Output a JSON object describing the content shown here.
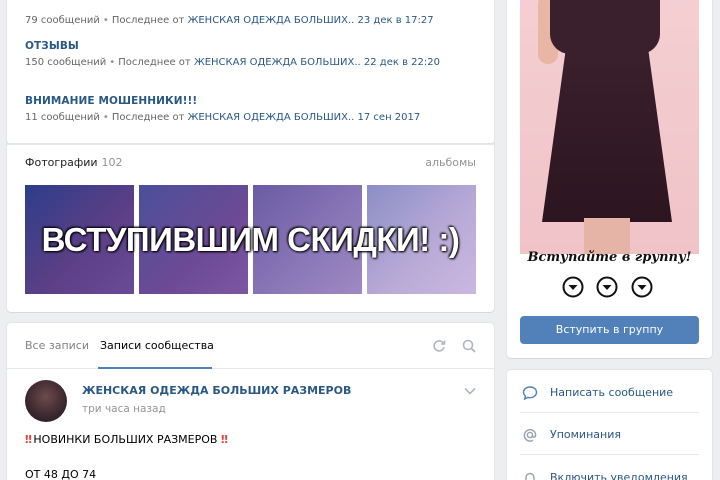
{
  "topics": [
    {
      "title": "",
      "count": "79 сообщений",
      "last_prefix": "Последнее от",
      "last_author": "ЖЕНСКАЯ ОДЕЖДА БОЛЬШИХ..",
      "last_date": "23 дек в 17:27"
    },
    {
      "title": "ОТЗЫВЫ",
      "count": "150 сообщений",
      "last_prefix": "Последнее от",
      "last_author": "ЖЕНСКАЯ ОДЕЖДА БОЛЬШИХ..",
      "last_date": "22 дек в 22:20"
    },
    {
      "title": "ВНИМАНИЕ МОШЕННИКИ!!!",
      "count": "11 сообщений",
      "last_prefix": "Последнее от",
      "last_author": "ЖЕНСКАЯ ОДЕЖДА БОЛЬШИХ..",
      "last_date": "17 сен 2017"
    }
  ],
  "photos": {
    "label": "Фотографии",
    "count": "102",
    "albums_link": "альбомы",
    "banner_text": "ВСТУПИВШИМ СКИДКИ! :)"
  },
  "wall": {
    "tabs": [
      {
        "label": "Все записи",
        "active": false
      },
      {
        "label": "Записи сообщества",
        "active": true
      }
    ],
    "icons": [
      "refresh-icon",
      "search-icon"
    ],
    "post": {
      "author": "ЖЕНСКАЯ ОДЕЖДА БОЛЬШИХ РАЗМЕРОВ",
      "time": "три часа назад",
      "line1_bang": "‼",
      "line1_text": "НОВИНКИ БОЛЬШИХ РАЗМЕРОВ",
      "line2_text": "ОТ 48 ДО 74"
    }
  },
  "cover": {
    "caption": "Вступайте в группу!",
    "join_button": "Вступить в группу"
  },
  "actions": [
    {
      "label": "Написать сообщение",
      "icon": "message-icon"
    },
    {
      "label": "Упоминания",
      "icon": "at-icon"
    },
    {
      "label": "Включить уведомления",
      "icon": "bell-icon"
    }
  ],
  "colors": {
    "link": "#2a5885",
    "accent": "#5181b8",
    "background": "#edeef0",
    "muted": "#939393"
  }
}
